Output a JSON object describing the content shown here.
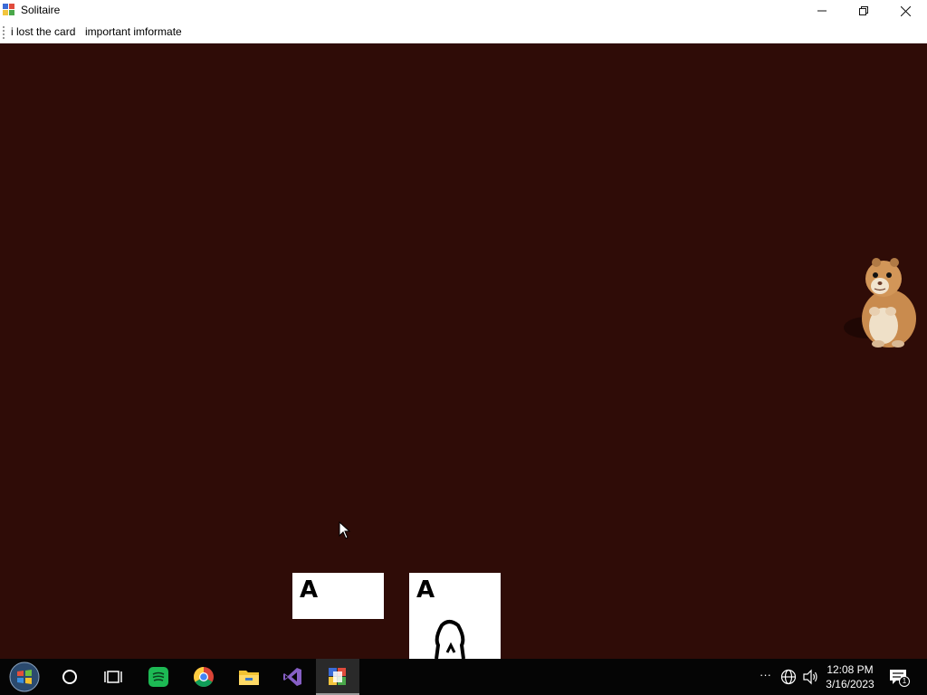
{
  "window": {
    "title": "Solitaire",
    "icon": "solitaire-cards-icon",
    "controls": [
      "minimize-icon",
      "restore-icon",
      "close-icon"
    ]
  },
  "menu": {
    "items": [
      {
        "label": "i lost the card"
      },
      {
        "label": "important imformate"
      }
    ]
  },
  "game": {
    "background": "#2f0c07",
    "cards": [
      {
        "rank": "A"
      },
      {
        "rank": "A"
      }
    ],
    "mascot": "hamster-image"
  },
  "taskbar": {
    "apps": [
      "windows-start-icon",
      "cortana-circle-icon",
      "task-view-icon",
      "spotify-icon",
      "chrome-icon",
      "file-explorer-icon",
      "visual-studio-icon",
      "solitaire-app-icon"
    ],
    "tray": [
      "more-dots-icon",
      "network-globe-icon",
      "volume-icon"
    ],
    "time": "12:08 PM",
    "date": "3/16/2023",
    "notification_count": "1"
  }
}
